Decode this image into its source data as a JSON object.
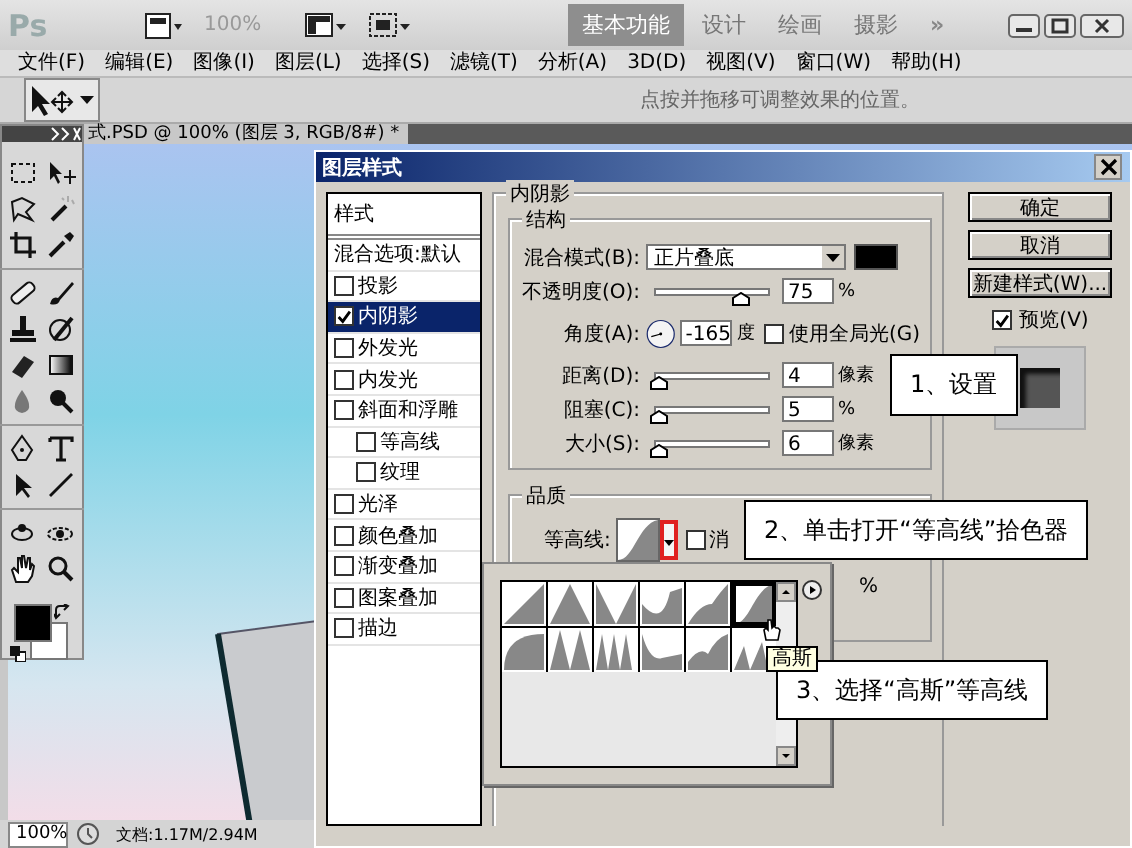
{
  "app": {
    "logo": "Ps",
    "zoom": "100%",
    "more": "»",
    "workspaces": [
      {
        "label": "基本功能",
        "selected": true
      },
      {
        "label": "设计",
        "selected": false
      },
      {
        "label": "绘画",
        "selected": false
      },
      {
        "label": "摄影",
        "selected": false
      }
    ]
  },
  "menu": [
    "文件(F)",
    "编辑(E)",
    "图像(I)",
    "图层(L)",
    "选择(S)",
    "滤镜(T)",
    "分析(A)",
    "3D(D)",
    "视图(V)",
    "窗口(W)",
    "帮助(H)"
  ],
  "options_bar": {
    "hint": "点按并拖移可调整效果的位置。"
  },
  "document": {
    "tab": "式.PSD @ 100% (图层 3, RGB/8#) *"
  },
  "status_bar": {
    "zoom": "100%",
    "doc_size": "文档:1.17M/2.94M"
  },
  "dialog": {
    "title": "图层样式",
    "styles_header": "样式",
    "blend_options": "混合选项:默认",
    "styles": [
      {
        "label": "投影",
        "checked": false,
        "selected": false
      },
      {
        "label": "内阴影",
        "checked": true,
        "selected": true
      },
      {
        "label": "外发光",
        "checked": false,
        "selected": false
      },
      {
        "label": "内发光",
        "checked": false,
        "selected": false
      },
      {
        "label": "斜面和浮雕",
        "checked": false,
        "selected": false,
        "children": [
          {
            "label": "等高线",
            "checked": false,
            "selected": false
          },
          {
            "label": "纹理",
            "checked": false,
            "selected": false
          }
        ]
      },
      {
        "label": "光泽",
        "checked": false,
        "selected": false
      },
      {
        "label": "颜色叠加",
        "checked": false,
        "selected": false
      },
      {
        "label": "渐变叠加",
        "checked": false,
        "selected": false
      },
      {
        "label": "图案叠加",
        "checked": false,
        "selected": false
      },
      {
        "label": "描边",
        "checked": false,
        "selected": false
      }
    ],
    "panel": {
      "title": "内阴影",
      "structure_title": "结构",
      "rows": [
        {
          "kind": "select",
          "label": "混合模式(B):",
          "value": "正片叠底"
        },
        {
          "kind": "slider",
          "label": "不透明度(O):",
          "level": 0.75,
          "value": "75",
          "unit": "%"
        },
        {
          "kind": "angle",
          "label": "角度(A):",
          "value": "-165",
          "unit": "度",
          "check_label": "使用全局光(G)",
          "checked": false
        },
        {
          "kind": "slider",
          "label": "距离(D):",
          "level": 0.02,
          "value": "4",
          "unit": "像素"
        },
        {
          "kind": "slider",
          "label": "阻塞(C):",
          "level": 0.02,
          "value": "5",
          "unit": "%"
        },
        {
          "kind": "slider",
          "label": "大小(S):",
          "level": 0.02,
          "value": "6",
          "unit": "像素"
        }
      ],
      "quality_title": "品质",
      "contour_label": "等高线:",
      "anti_alias_label": "消",
      "anti_alias_checked": false,
      "noise_unit": "%"
    },
    "buttons": [
      "确定",
      "取消",
      "新建样式(W)..."
    ],
    "preview": {
      "label": "预览(V)",
      "checked": true
    }
  },
  "contour_picker": {
    "tooltip": "高斯",
    "contours": [
      {
        "selected": false
      },
      {
        "selected": false
      },
      {
        "selected": false
      },
      {
        "selected": false
      },
      {
        "selected": false
      },
      {
        "selected": true
      },
      {
        "selected": false
      },
      {
        "selected": false
      },
      {
        "selected": false
      },
      {
        "selected": false
      },
      {
        "selected": false
      },
      {
        "selected": false
      }
    ]
  },
  "callouts": [
    "1、设置",
    "2、单击打开“等高线”拾色器",
    "3、选择“高斯”等高线"
  ]
}
